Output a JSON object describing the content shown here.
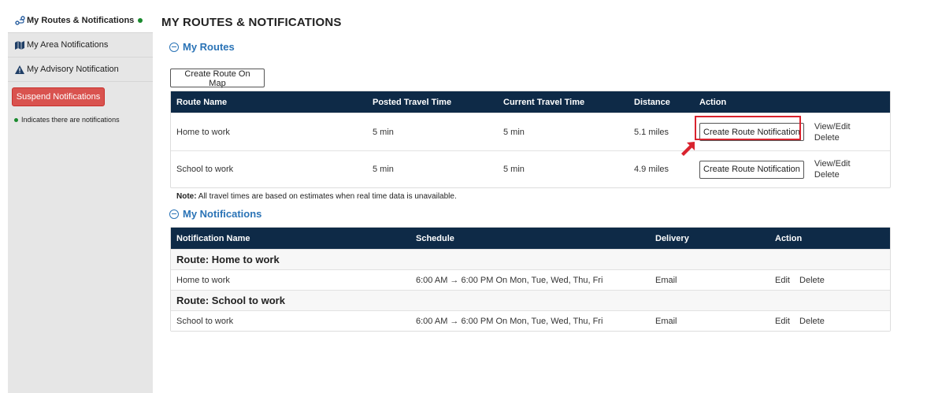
{
  "sidebar": {
    "items": [
      {
        "label": "My Routes & Notifications",
        "icon": "route-icon"
      },
      {
        "label": "My Area Notifications",
        "icon": "map-icon"
      },
      {
        "label": "My Advisory Notification",
        "icon": "warning-icon"
      }
    ],
    "suspend_label": "Suspend Notifications",
    "legend_text": "Indicates there are notifications",
    "indicator_color": "#1a8a2e"
  },
  "page": {
    "title": "MY ROUTES & NOTIFICATIONS"
  },
  "routes": {
    "title": "My Routes",
    "create_on_map_label": "Create Route On Map",
    "columns": [
      "Route Name",
      "Posted Travel Time",
      "Current Travel Time",
      "Distance",
      "Action"
    ],
    "rows": [
      {
        "name": "Home to work",
        "posted": "5 min",
        "current": "5 min",
        "distance": "5.1 miles",
        "create_label": "Create Route Notification",
        "view_label": "View/Edit",
        "delete_label": "Delete"
      },
      {
        "name": "School to work",
        "posted": "5 min",
        "current": "5 min",
        "distance": "4.9 miles",
        "create_label": "Create Route Notification",
        "view_label": "View/Edit",
        "delete_label": "Delete"
      }
    ],
    "note_label": "Note:",
    "note_text": " All travel times are based on estimates when real time data is unavailable."
  },
  "notifications": {
    "title": "My Notifications",
    "columns": [
      "Notification Name",
      "Schedule",
      "Delivery",
      "Action"
    ],
    "groups": [
      {
        "group_label": "Route: Home to work",
        "name": "Home to work",
        "schedule": "6:00 AM → 6:00 PM On Mon, Tue, Wed, Thu, Fri",
        "delivery": "Email",
        "edit_label": "Edit",
        "delete_label": "Delete"
      },
      {
        "group_label": "Route: School to work",
        "name": "School to work",
        "schedule": "6:00 AM → 6:00 PM On Mon, Tue, Wed, Thu, Fri",
        "delivery": "Email",
        "edit_label": "Edit",
        "delete_label": "Delete"
      }
    ]
  },
  "colors": {
    "header_bg": "#0e2a47",
    "accent_blue": "#2a73b6",
    "danger": "#d9534f",
    "highlight": "#d9232e"
  }
}
